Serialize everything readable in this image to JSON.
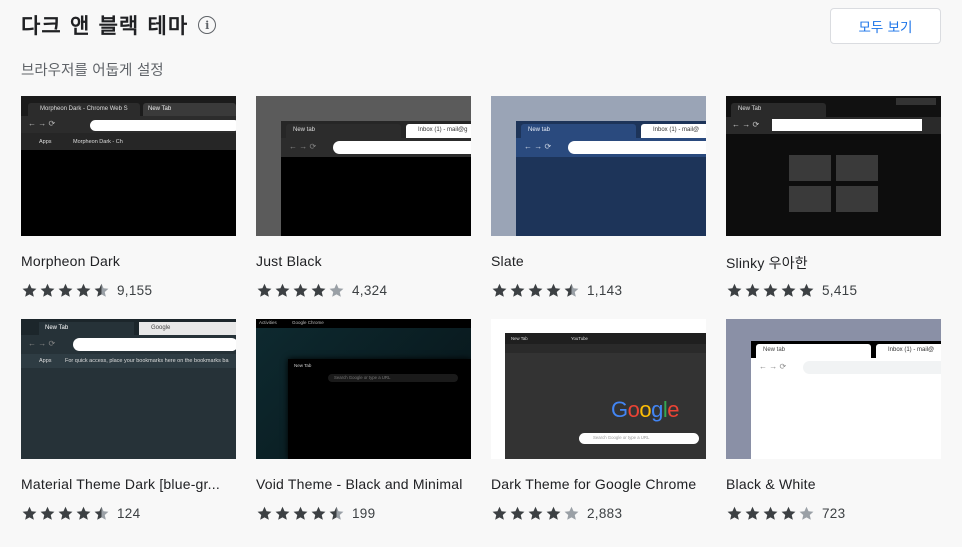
{
  "header": {
    "title": "다크 앤 블랙 테마",
    "subtitle": "브라우저를 어둡게 설정",
    "view_all_label": "모두 보기",
    "info_glyph": "i"
  },
  "colors": {
    "star": "#3c4043",
    "star_empty": "#9aa0a6",
    "link_blue": "#1a73e8"
  },
  "themes": [
    {
      "name": "Morpheon Dark",
      "rating": 4.5,
      "count": "9,155",
      "thumb": "morpheon",
      "tabs": [
        "Morpheon Dark - Chrome Web S",
        "New Tab"
      ],
      "bookmarks": [
        "Apps",
        "Morpheon Dark - Ch"
      ]
    },
    {
      "name": "Just Black",
      "rating": 4,
      "count": "4,324",
      "thumb": "justblack",
      "tabs": [
        "New tab",
        "Inbox (1) - mail@g"
      ]
    },
    {
      "name": "Slate",
      "rating": 4.5,
      "count": "1,143",
      "thumb": "slate",
      "tabs": [
        "New tab",
        "Inbox (1) - mail@"
      ]
    },
    {
      "name": "Slinky 우아한",
      "rating": 5,
      "count": "5,415",
      "thumb": "slinky",
      "tabs": [
        "New Tab"
      ]
    },
    {
      "name": "Material Theme Dark [blue-gr...",
      "rating": 4.5,
      "count": "124",
      "thumb": "material",
      "tabs": [
        "New Tab",
        "Google"
      ],
      "bookmarks": [
        "Apps",
        "For quick access, place your bookmarks here on the bookmarks ba"
      ]
    },
    {
      "name": "Void Theme - Black and Minimal",
      "rating": 4.5,
      "count": "199",
      "thumb": "void",
      "tabs": [
        "Activities",
        "Google Chrome",
        "New Tab"
      ],
      "search_placeholder": "Search Google or type a URL"
    },
    {
      "name": "Dark Theme for Google Chrome",
      "rating": 4,
      "count": "2,883",
      "thumb": "darkgoogle",
      "tabs": [
        "New Tab",
        "YouTube"
      ],
      "search_placeholder": "Search Google or type a URL",
      "logo": "Google"
    },
    {
      "name": "Black & White",
      "rating": 4,
      "count": "723",
      "thumb": "blackwhite",
      "tabs": [
        "New tab",
        "Inbox (1) - mail@"
      ]
    }
  ]
}
